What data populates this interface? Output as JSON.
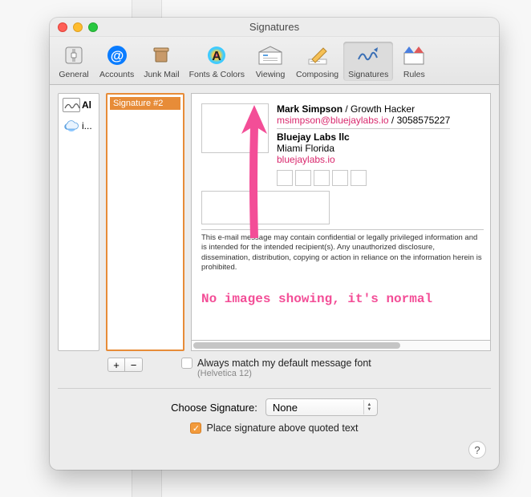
{
  "window": {
    "title": "Signatures"
  },
  "toolbar": {
    "items": [
      {
        "label": "General"
      },
      {
        "label": "Accounts"
      },
      {
        "label": "Junk Mail"
      },
      {
        "label": "Fonts & Colors"
      },
      {
        "label": "Viewing"
      },
      {
        "label": "Composing"
      },
      {
        "label": "Signatures"
      },
      {
        "label": "Rules"
      }
    ]
  },
  "accounts": {
    "all_label": "Al",
    "icloud_label": "i..."
  },
  "signature_list": {
    "item": "Signature #2"
  },
  "preview": {
    "name": "Mark Simpson",
    "role": "Growth Hacker",
    "email": "msimpson@bluejaylabs.io",
    "phone": "3058575227",
    "company": "Bluejay Labs llc",
    "location": "Miami Florida",
    "site": "bluejaylabs.io",
    "disclaimer": "This e-mail message may contain confidential or legally privileged information and is intended for the intended recipient(s). Any unauthorized disclosure, dissemination, distribution, copying or action in reliance on the information herein is prohibited."
  },
  "options": {
    "match_font_label": "Always match my default message font",
    "match_font_sub": "(Helvetica 12)",
    "choose_label": "Choose Signature:",
    "choose_value": "None",
    "place_label": "Place signature above quoted text",
    "place_checked": true
  },
  "annotation": {
    "text": "No images showing, it's normal"
  },
  "help": "?"
}
